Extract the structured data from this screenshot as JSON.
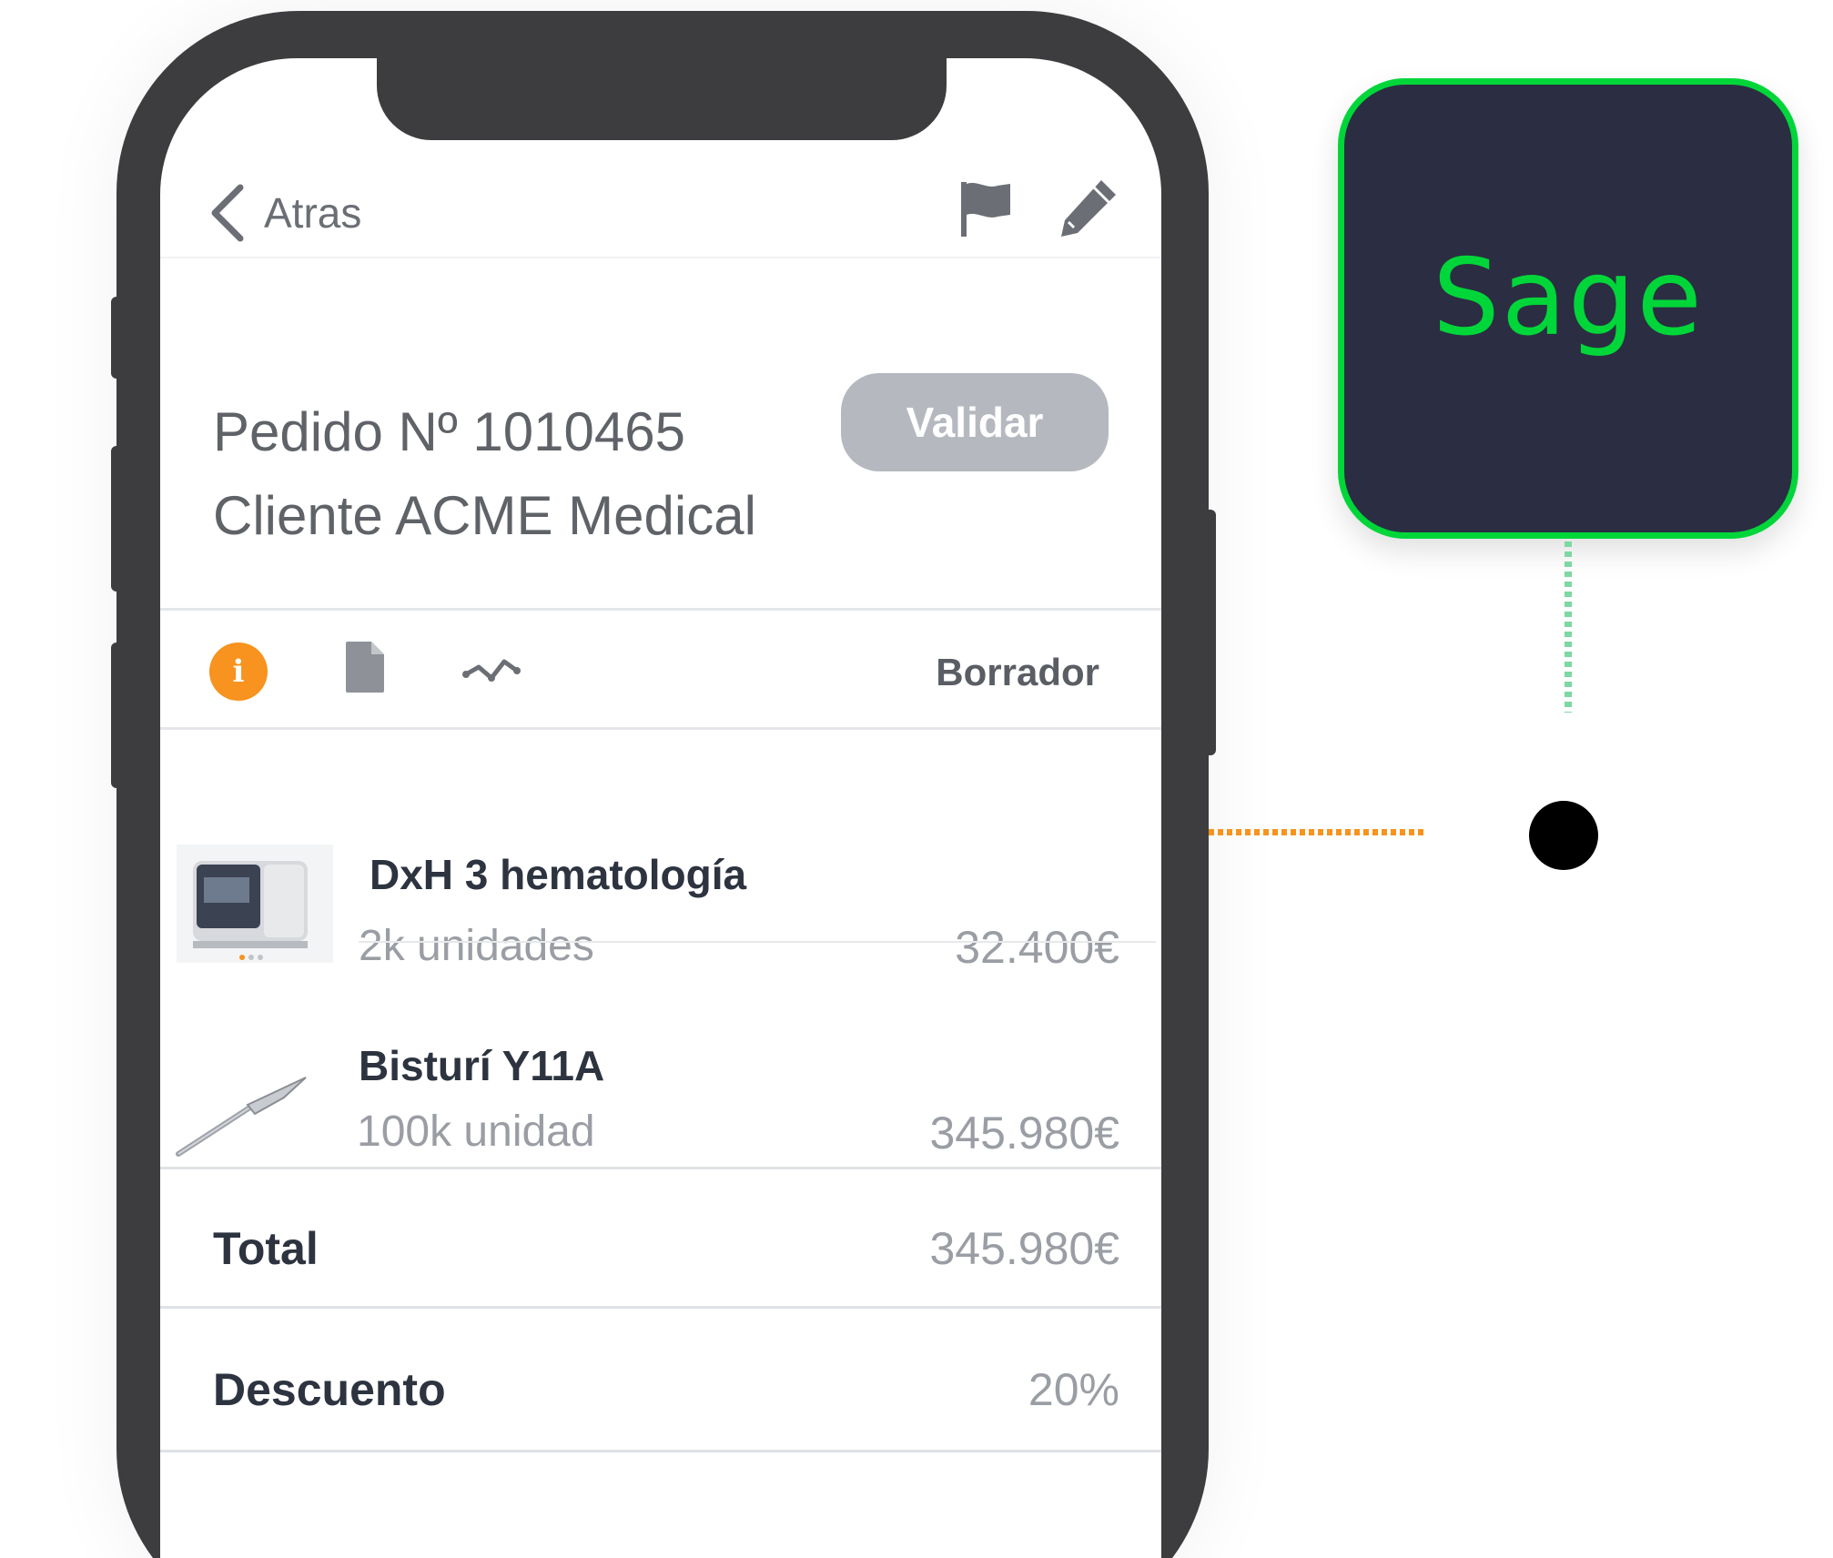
{
  "nav": {
    "back_label": "Atras"
  },
  "order": {
    "number_line": "Pedido Nº 1010465",
    "client_line": "Cliente ACME Medical",
    "validate_label": "Validar",
    "status": "Borrador"
  },
  "items": [
    {
      "name": "DxH 3  hematología",
      "quantity": "2k unidades",
      "price": "32.400€"
    },
    {
      "name": "Bisturí Y11A",
      "quantity": "100k unidad",
      "price": "345.980€"
    }
  ],
  "summary": {
    "total_label": "Total",
    "total_value": "345.980€",
    "discount_label": "Descuento",
    "discount_value": "20%"
  },
  "integration": {
    "logo_text": "Sage"
  },
  "icons": [
    "chevron-left-icon",
    "flag-icon",
    "pencil-icon",
    "info-icon",
    "document-icon",
    "activity-icon"
  ],
  "colors": {
    "accent_orange": "#f7931e",
    "sage_green": "#00d639",
    "sage_bg": "#2b2d42",
    "button_gray": "#b5b9bf"
  }
}
